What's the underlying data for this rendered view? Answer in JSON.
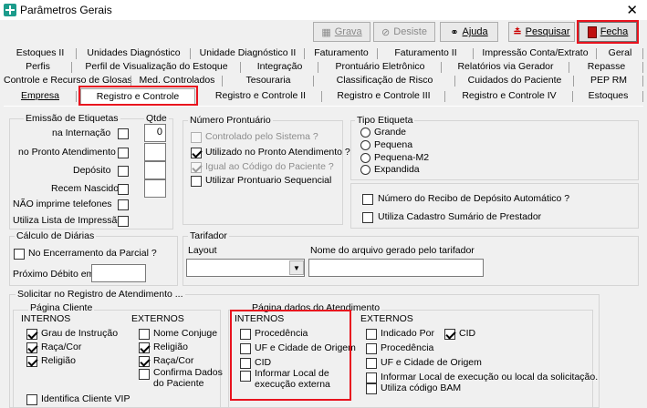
{
  "window": {
    "title": "Parâmetros Gerais",
    "close": "✕"
  },
  "toolbar": {
    "grava": "Grava",
    "desiste": "Desiste",
    "ajuda": "Ajuda",
    "pesquisar": "Pesquisar",
    "fecha": "Fecha"
  },
  "tabs": {
    "row1": [
      "Estoques II",
      "Unidades Diagnóstico",
      "Unidade Diagnóstico II",
      "Faturamento",
      "Faturamento II",
      "Impressão Conta/Extrato",
      "Geral"
    ],
    "row2": [
      "Perfis",
      "Perfil de Visualização do Estoque",
      "Integração",
      "Prontuário Eletrônico",
      "Relatórios via Gerador",
      "Repasse"
    ],
    "row3": [
      "Controle e Recurso de Glosas",
      "Med. Controlados",
      "Tesouraria",
      "Classificação de Risco",
      "Cuidados do Paciente",
      "PEP RM"
    ],
    "row4": [
      "Empresa",
      "Registro e Controle",
      "Registro e Controle II",
      "Registro e Controle III",
      "Registro e Controle IV",
      "Estoques"
    ]
  },
  "emissao": {
    "title": "Emissão de Etiquetas",
    "qtde_label": "Qtde",
    "na_internacao": "na Internação",
    "na_internacao_qtde": "0",
    "pronto_atendimento": "no Pronto Atendimento",
    "deposito": "Depósito",
    "recem_nascido": "Recem Nascido",
    "nao_imprime": "NÃO imprime telefones",
    "lista_impressao": "Utiliza Lista de Impressão"
  },
  "prontuario": {
    "title": "Número Prontuário",
    "controlado": "Controlado pelo Sistema ?",
    "utilizado_pa": "Utilizado no Pronto Atendimento ?",
    "igual_codigo": "Igual ao Código do Paciente ?",
    "sequencial": "Utilizar Prontuario Sequencial"
  },
  "tipo_etiqueta": {
    "title": "Tipo Etiqueta",
    "options": [
      "Grande",
      "Pequena",
      "Pequena-M2",
      "Expandida"
    ]
  },
  "misc": {
    "recibo": "Número do Recibo de Depósito Automático ?",
    "cadastro_sumario": "Utiliza Cadastro Sumário de Prestador"
  },
  "diarias": {
    "title": "Cálculo de Diárias",
    "encerramento": "No Encerramento da Parcial ?",
    "proximo_debito": "Próximo Débito em"
  },
  "tarifador": {
    "title": "Tarifador",
    "layout": "Layout",
    "arquivo": "Nome do arquivo gerado pelo tarifador"
  },
  "solicitar": {
    "title": "Solicitar no Registro de Atendimento ...",
    "pagina_cliente": "Página Cliente",
    "internos": "INTERNOS",
    "externos": "EXTERNOS",
    "cli_int": [
      "Grau de Instrução",
      "Raça/Cor",
      "Religião"
    ],
    "cli_ext": [
      "Nome Conjuge",
      "Religião",
      "Raça/Cor",
      "Confirma Dados",
      "do Paciente"
    ],
    "identifica_vip": "Identifica Cliente VIP",
    "pagina_atendimento": "Página dados do Atendimento",
    "at_int": [
      "Procedência",
      "UF e Cidade de Origem",
      "CID",
      "Informar Local de",
      "execução externa"
    ],
    "at_ext": [
      "Indicado Por",
      "CID",
      "Procedência",
      "UF e Cidade de Origem",
      "Informar Local de execução ou local da solicitação.",
      "Utiliza código BAM"
    ]
  }
}
